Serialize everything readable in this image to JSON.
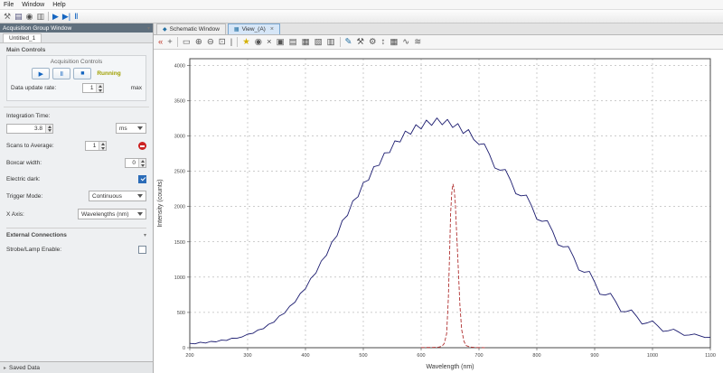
{
  "window": {
    "menu": [
      "File",
      "Window",
      "Help"
    ]
  },
  "toolbar": {
    "icons": [
      {
        "name": "tools-icon",
        "glyph": "⚒",
        "color": "#6b6b6b"
      },
      {
        "name": "save-icon",
        "glyph": "▤",
        "color": "#55557f"
      },
      {
        "name": "camera-icon",
        "glyph": "◉",
        "color": "#4d4d4d"
      },
      {
        "name": "print-icon",
        "glyph": "▥",
        "color": "#6b6b6b"
      },
      {
        "name": "sep",
        "glyph": "",
        "color": ""
      },
      {
        "name": "play-icon",
        "glyph": "▶",
        "color": "#1565c0"
      },
      {
        "name": "play-pause-icon",
        "glyph": "▶|",
        "color": "#1565c0"
      },
      {
        "name": "pause-icon",
        "glyph": "Ⅱ",
        "color": "#1565c0"
      }
    ]
  },
  "left_panel": {
    "title": "Acquisition Group Window",
    "tab_label": "Untitled_1",
    "main_controls_label": "Main Controls",
    "group_title": "Acquisition Controls",
    "play_glyph": "▶",
    "pause_glyph": "Ⅱ",
    "stop_glyph": "■",
    "running_label": "Running",
    "data_update_rate_label": "Data update rate:",
    "data_update_rate_value": "1",
    "data_update_rate_suffix": "max",
    "integration_time_label": "Integration Time:",
    "integration_time_value": "3.8",
    "integration_time_unit": "ms",
    "scans_label": "Scans to Average:",
    "scans_value": "1",
    "boxcar_label": "Boxcar width:",
    "boxcar_value": "0",
    "electric_dark_label": "Electric dark:",
    "trigger_label": "Trigger Mode:",
    "trigger_value": "Continuous",
    "xaxis_label": "X Axis:",
    "xaxis_value": "Wavelengths (nm)",
    "external_section_label": "External Connections",
    "strobe_label": "Strobe/Lamp Enable:",
    "saved_data_label": "Saved Data",
    "saved_data_chevron": "▸"
  },
  "main": {
    "tabs": [
      {
        "label": "Schematic Window"
      },
      {
        "label": "View_(A)"
      }
    ],
    "close_glyph": "×",
    "tab1_icon_glyph": "◆",
    "tab2_icon_glyph": "▦",
    "chart_toolbar_icons": [
      {
        "name": "page-back-icon",
        "glyph": "«",
        "color": "#c0392b"
      },
      {
        "name": "pan-icon",
        "glyph": "+",
        "color": "#555555"
      },
      {
        "name": "sep",
        "glyph": "",
        "color": ""
      },
      {
        "name": "zoom-window-icon",
        "glyph": "▭",
        "color": "#555555"
      },
      {
        "name": "zoom-in-icon",
        "glyph": "⊕",
        "color": "#555555"
      },
      {
        "name": "zoom-out-icon",
        "glyph": "⊖",
        "color": "#555555"
      },
      {
        "name": "zoom-extents-icon",
        "glyph": "⊡",
        "color": "#555555"
      },
      {
        "name": "cursor-line-icon",
        "glyph": "|",
        "color": "#555555"
      },
      {
        "name": "sep",
        "glyph": "",
        "color": ""
      },
      {
        "name": "highlight-icon",
        "glyph": "★",
        "color": "#d4b106"
      },
      {
        "name": "snapshot-icon",
        "glyph": "◉",
        "color": "#555555"
      },
      {
        "name": "delete-icon",
        "glyph": "×",
        "color": "#555555"
      },
      {
        "name": "copy-icon",
        "glyph": "▣",
        "color": "#555555"
      },
      {
        "name": "paste-icon",
        "glyph": "▤",
        "color": "#555555"
      },
      {
        "name": "save-spectrum-icon",
        "glyph": "▦",
        "color": "#555555"
      },
      {
        "name": "export-icon",
        "glyph": "▧",
        "color": "#555555"
      },
      {
        "name": "print-chart-icon",
        "glyph": "▥",
        "color": "#555555"
      },
      {
        "name": "sep",
        "glyph": "",
        "color": ""
      },
      {
        "name": "annotate-icon",
        "glyph": "✎",
        "color": "#2471a3"
      },
      {
        "name": "tools-icon",
        "glyph": "⚒",
        "color": "#555555"
      },
      {
        "name": "config-icon",
        "glyph": "⚙",
        "color": "#555555"
      },
      {
        "name": "autoscale-icon",
        "glyph": "↕",
        "color": "#555555"
      },
      {
        "name": "table-view-icon",
        "glyph": "▦",
        "color": "#555555"
      },
      {
        "name": "peak-finding-icon",
        "glyph": "∿",
        "color": "#555555"
      },
      {
        "name": "overlay-icon",
        "glyph": "≋",
        "color": "#555555"
      }
    ]
  },
  "chart_data": {
    "type": "line",
    "title": "",
    "xlabel": "Wavelength (nm)",
    "ylabel": "Intensity (counts)",
    "xlim": [
      200,
      1100
    ],
    "ylim": [
      0,
      4095
    ],
    "x_tick_step": 100,
    "y_tick_step": 500,
    "grid": true,
    "legend": "none",
    "series": [
      {
        "name": "spectrum",
        "color": "#1b1b6f",
        "dashed": false,
        "x_start": 200,
        "x_end": 1100,
        "values": [
          62,
          55,
          78,
          66,
          90,
          83,
          108,
          104,
          135,
          136,
          155,
          192,
          203,
          252,
          270,
          333,
          362,
          448,
          487,
          588,
          645,
          768,
          835,
          982,
          1058,
          1228,
          1310,
          1495,
          1585,
          1800,
          1875,
          2080,
          2140,
          2340,
          2375,
          2565,
          2585,
          2760,
          2765,
          2930,
          2915,
          3070,
          3025,
          3160,
          3100,
          3225,
          3150,
          3255,
          3160,
          3235,
          3120,
          3175,
          3035,
          3090,
          2950,
          2880,
          2890,
          2740,
          2547,
          2516,
          2525,
          2374,
          2183,
          2152,
          2161,
          2010,
          1820,
          1790,
          1800,
          1650,
          1460,
          1430,
          1435,
          1285,
          1100,
          1070,
          1080,
          930,
          758,
          746,
          771,
          653,
          511,
          511,
          535,
          444,
          335,
          352,
          380,
          310,
          232,
          240,
          262,
          221,
          175,
          181,
          194,
          169,
          145,
          148
        ]
      },
      {
        "name": "reference-peak",
        "color": "#b03030",
        "dashed": true,
        "points": [
          [
            600,
            2
          ],
          [
            620,
            4
          ],
          [
            630,
            8
          ],
          [
            636,
            20
          ],
          [
            640,
            60
          ],
          [
            644,
            200
          ],
          [
            647,
            700
          ],
          [
            649,
            1300
          ],
          [
            651,
            1900
          ],
          [
            653,
            2200
          ],
          [
            655,
            2320
          ],
          [
            657,
            2250
          ],
          [
            659,
            2050
          ],
          [
            661,
            1700
          ],
          [
            664,
            1150
          ],
          [
            667,
            600
          ],
          [
            670,
            260
          ],
          [
            674,
            90
          ],
          [
            678,
            30
          ],
          [
            684,
            10
          ],
          [
            695,
            3
          ],
          [
            710,
            1
          ]
        ]
      }
    ]
  }
}
